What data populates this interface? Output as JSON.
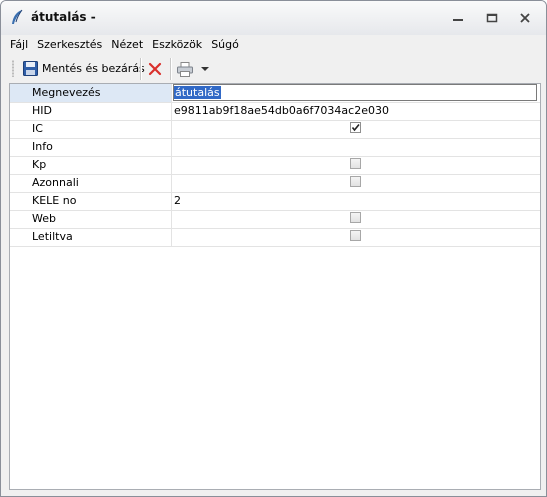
{
  "window": {
    "title": "átutalás -"
  },
  "menu": {
    "items": [
      "Fájl",
      "Szerkesztés",
      "Nézet",
      "Eszközök",
      "Súgó"
    ]
  },
  "toolbar": {
    "save_label": "Mentés és bezárás",
    "save_icon": "floppy-disk-icon",
    "delete_icon": "red-x-icon",
    "print_icon": "printer-icon",
    "dropdown_icon": "chevron-down-icon"
  },
  "grid": {
    "rows": [
      {
        "label": "Megnevezés",
        "value": "átutalás",
        "type": "text-edit"
      },
      {
        "label": "HID",
        "value": "e9811ab9f18ae54db0a6f7034ac2e030",
        "type": "text"
      },
      {
        "label": "IC",
        "value": "",
        "type": "checkbox",
        "checked": true
      },
      {
        "label": "Info",
        "value": "",
        "type": "text"
      },
      {
        "label": "Kp",
        "value": "",
        "type": "checkbox",
        "checked": false
      },
      {
        "label": "Azonnali",
        "value": "",
        "type": "checkbox",
        "checked": false
      },
      {
        "label": "KELE no",
        "value": "2",
        "type": "text"
      },
      {
        "label": "Web",
        "value": "",
        "type": "checkbox",
        "checked": false
      },
      {
        "label": "Letiltva",
        "value": "",
        "type": "checkbox",
        "checked": false
      }
    ]
  },
  "colors": {
    "selection": "#3169c6",
    "selected_row": "#dde8f5",
    "delete_red": "#d9302c"
  }
}
